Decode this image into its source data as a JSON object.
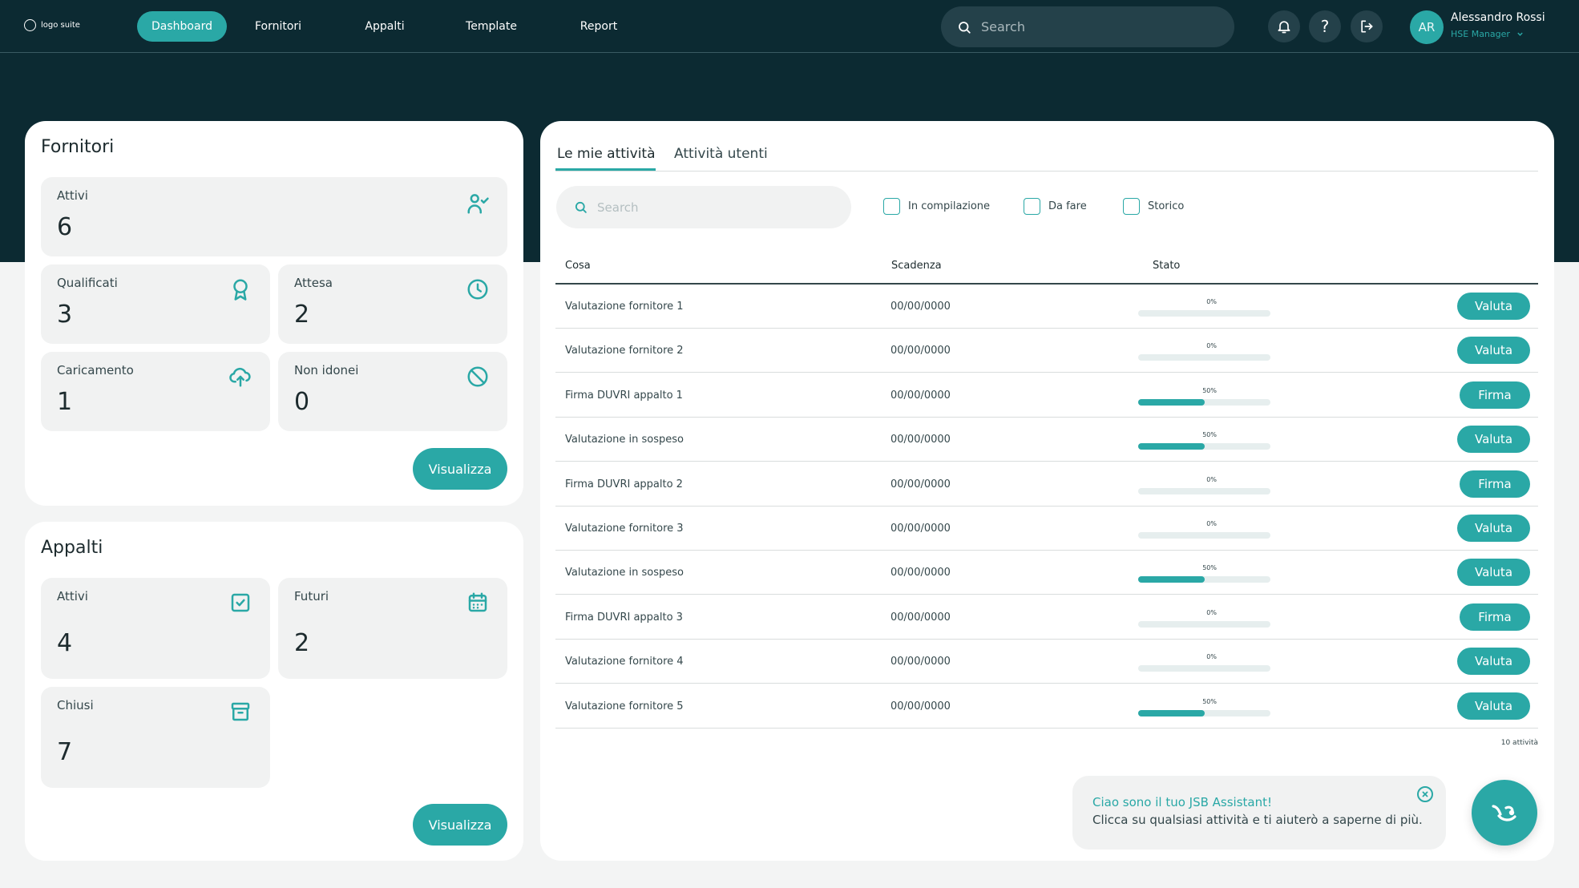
{
  "brand": {
    "logo_text": "logo suite"
  },
  "colors": {
    "accent": "#2aa8a6",
    "header_bg": "#0c2a32",
    "card_bg": "#ffffff",
    "tile_bg": "#f1f2f2"
  },
  "nav": [
    {
      "label": "Dashboard",
      "active": true
    },
    {
      "label": "Fornitori",
      "active": false
    },
    {
      "label": "Appalti",
      "active": false
    },
    {
      "label": "Template",
      "active": false
    },
    {
      "label": "Report",
      "active": false
    }
  ],
  "top_search": {
    "placeholder": "Search"
  },
  "header_icons": [
    "bell-icon",
    "help-icon",
    "logout-icon"
  ],
  "user": {
    "initials": "AR",
    "name": "Alessandro Rossi",
    "role": "HSE Manager"
  },
  "fornitori": {
    "title": "Fornitori",
    "stats": [
      {
        "label": "Attivi",
        "value": "6",
        "icon": "user-check-icon"
      },
      {
        "label": "Qualificati",
        "value": "3",
        "icon": "award-icon"
      },
      {
        "label": "Attesa",
        "value": "2",
        "icon": "clock-icon"
      },
      {
        "label": "Caricamento",
        "value": "1",
        "icon": "upload-cloud-icon"
      },
      {
        "label": "Non idonei",
        "value": "0",
        "icon": "ban-icon"
      }
    ],
    "button": "Visualizza"
  },
  "appalti": {
    "title": "Appalti",
    "stats": [
      {
        "label": "Attivi",
        "value": "4",
        "icon": "checkbox-icon"
      },
      {
        "label": "Futuri",
        "value": "2",
        "icon": "calendar-icon"
      },
      {
        "label": "Chiusi",
        "value": "7",
        "icon": "archive-icon"
      }
    ],
    "button": "Visualizza"
  },
  "activities": {
    "tabs": [
      {
        "label": "Le mie attività",
        "active": true
      },
      {
        "label": "Attività utenti",
        "active": false
      }
    ],
    "search_placeholder": "Search",
    "filters": [
      {
        "label": "In compilazione",
        "checked": false
      },
      {
        "label": "Da fare",
        "checked": false
      },
      {
        "label": "Storico",
        "checked": false
      }
    ],
    "columns": {
      "what": "Cosa",
      "deadline": "Scadenza",
      "status": "Stato"
    },
    "rows": [
      {
        "what": "Valutazione fornitore 1",
        "deadline": "00/00/0000",
        "progress": 0,
        "progress_label": "0%",
        "action": "Valuta"
      },
      {
        "what": "Valutazione fornitore 2",
        "deadline": "00/00/0000",
        "progress": 0,
        "progress_label": "0%",
        "action": "Valuta"
      },
      {
        "what": "Firma DUVRI appalto 1",
        "deadline": "00/00/0000",
        "progress": 50,
        "progress_label": "50%",
        "action": "Firma"
      },
      {
        "what": "Valutazione in sospeso",
        "deadline": "00/00/0000",
        "progress": 50,
        "progress_label": "50%",
        "action": "Valuta"
      },
      {
        "what": "Firma DUVRI appalto 2",
        "deadline": "00/00/0000",
        "progress": 0,
        "progress_label": "0%",
        "action": "Firma"
      },
      {
        "what": "Valutazione fornitore 3",
        "deadline": "00/00/0000",
        "progress": 0,
        "progress_label": "0%",
        "action": "Valuta"
      },
      {
        "what": "Valutazione in sospeso",
        "deadline": "00/00/0000",
        "progress": 50,
        "progress_label": "50%",
        "action": "Valuta"
      },
      {
        "what": "Firma DUVRI appalto 3",
        "deadline": "00/00/0000",
        "progress": 0,
        "progress_label": "0%",
        "action": "Firma"
      },
      {
        "what": "Valutazione fornitore 4",
        "deadline": "00/00/0000",
        "progress": 0,
        "progress_label": "0%",
        "action": "Valuta"
      },
      {
        "what": "Valutazione fornitore 5",
        "deadline": "00/00/0000",
        "progress": 50,
        "progress_label": "50%",
        "action": "Valuta"
      }
    ],
    "count_label": "10 attività"
  },
  "assistant": {
    "title": "Ciao sono il tuo JSB Assistant!",
    "text": "Clicca su qualsiasi attività e ti aiuterò a saperne di più."
  }
}
